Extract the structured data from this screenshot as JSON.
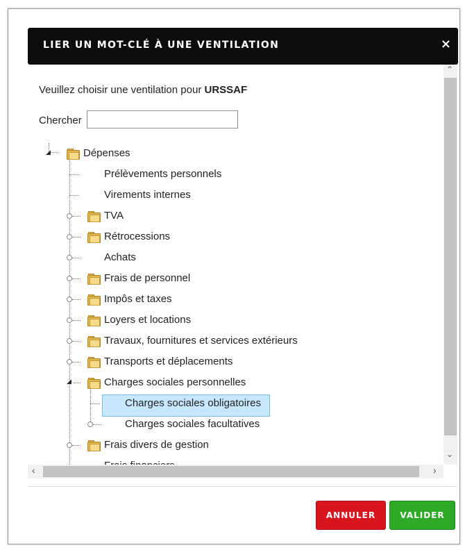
{
  "dialog": {
    "title": "LIER UN MOT-CLÉ À UNE VENTILATION",
    "close_glyph": "×",
    "intro_prefix": "Veuillez choisir une ventilation pour ",
    "intro_target": "URSSAF",
    "search_label": "Chercher",
    "search_value": "",
    "cancel_label": "ANNULER",
    "ok_label": "VALIDER"
  },
  "tree": {
    "root": "Dépenses",
    "items": [
      "Prélèvements personnels",
      "Virements internes",
      "TVA",
      "Rétrocessions",
      "Achats",
      "Frais de personnel",
      "Impôs et taxes",
      "Loyers et locations",
      "Travaux, fournitures et services extérieurs",
      "Transports et déplacements",
      "Charges sociales personnelles",
      "Charges sociales obligatoires",
      "Charges sociales facultatives",
      "Frais divers de gestion",
      "Frais financiers"
    ],
    "selected": "Charges sociales obligatoires"
  },
  "scroll": {
    "up_glyph": "⌃",
    "down_glyph": "⌄",
    "left_glyph": "‹",
    "right_glyph": "›"
  },
  "colors": {
    "titlebar": "#0c0c0c",
    "cancel": "#d8141f",
    "ok": "#2eaa28",
    "selection": "#c7e7ff"
  },
  "icons": [
    "folder-icon",
    "close-icon",
    "expander-icon"
  ]
}
